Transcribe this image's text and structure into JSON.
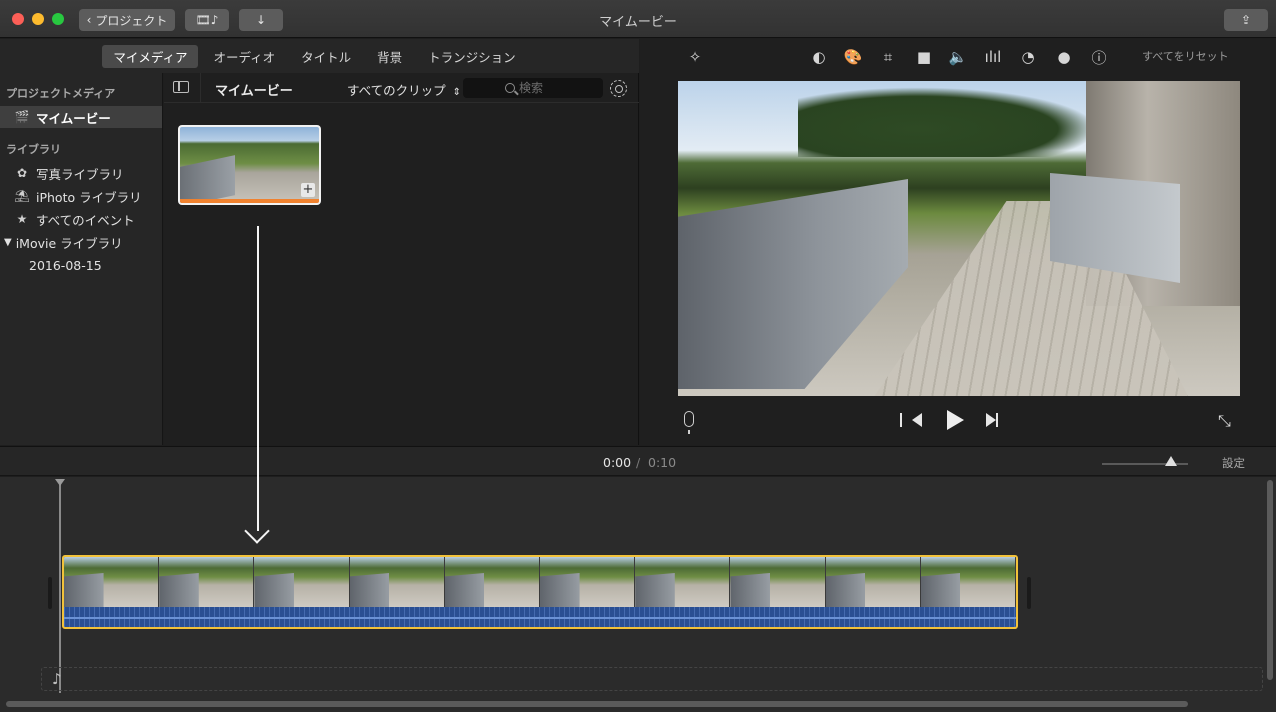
{
  "window": {
    "title": "マイムービー",
    "back_button": "プロジェクト"
  },
  "browser_tabs": [
    {
      "label": "マイメディア",
      "active": true
    },
    {
      "label": "オーディオ",
      "active": false
    },
    {
      "label": "タイトル",
      "active": false
    },
    {
      "label": "背景",
      "active": false
    },
    {
      "label": "トランジション",
      "active": false
    }
  ],
  "sidebar": {
    "project_media_header": "プロジェクトメディア",
    "project_item": "マイムービー",
    "library_header": "ライブラリ",
    "library_items": [
      {
        "label": "写真ライブラリ",
        "icon": "photos-icon"
      },
      {
        "label": "iPhoto ライブラリ",
        "icon": "iphoto-icon"
      },
      {
        "label": "すべてのイベント",
        "icon": "star-icon"
      }
    ],
    "imovie_library": "iMovie ライブラリ",
    "event": "2016-08-15"
  },
  "browser": {
    "title": "マイムービー",
    "filter": "すべてのクリップ",
    "search_placeholder": "検索",
    "clip_add_symbol": "+"
  },
  "viewer": {
    "reset_all": "すべてをリセット",
    "tools": [
      "magic-wand-icon",
      "color-balance-icon",
      "color-correction-icon",
      "crop-icon",
      "stabilization-icon",
      "volume-icon",
      "equalizer-icon",
      "speed-icon",
      "clip-filter-icon",
      "info-icon"
    ]
  },
  "timeline": {
    "current_time": "0:00",
    "separator": "/",
    "total_time": "0:10",
    "settings": "設定",
    "zoom_level": 0.8
  },
  "colors": {
    "accent_yellow": "#f2c23a",
    "used_orange": "#f0822f",
    "audio_blue": "#2b56a0"
  }
}
